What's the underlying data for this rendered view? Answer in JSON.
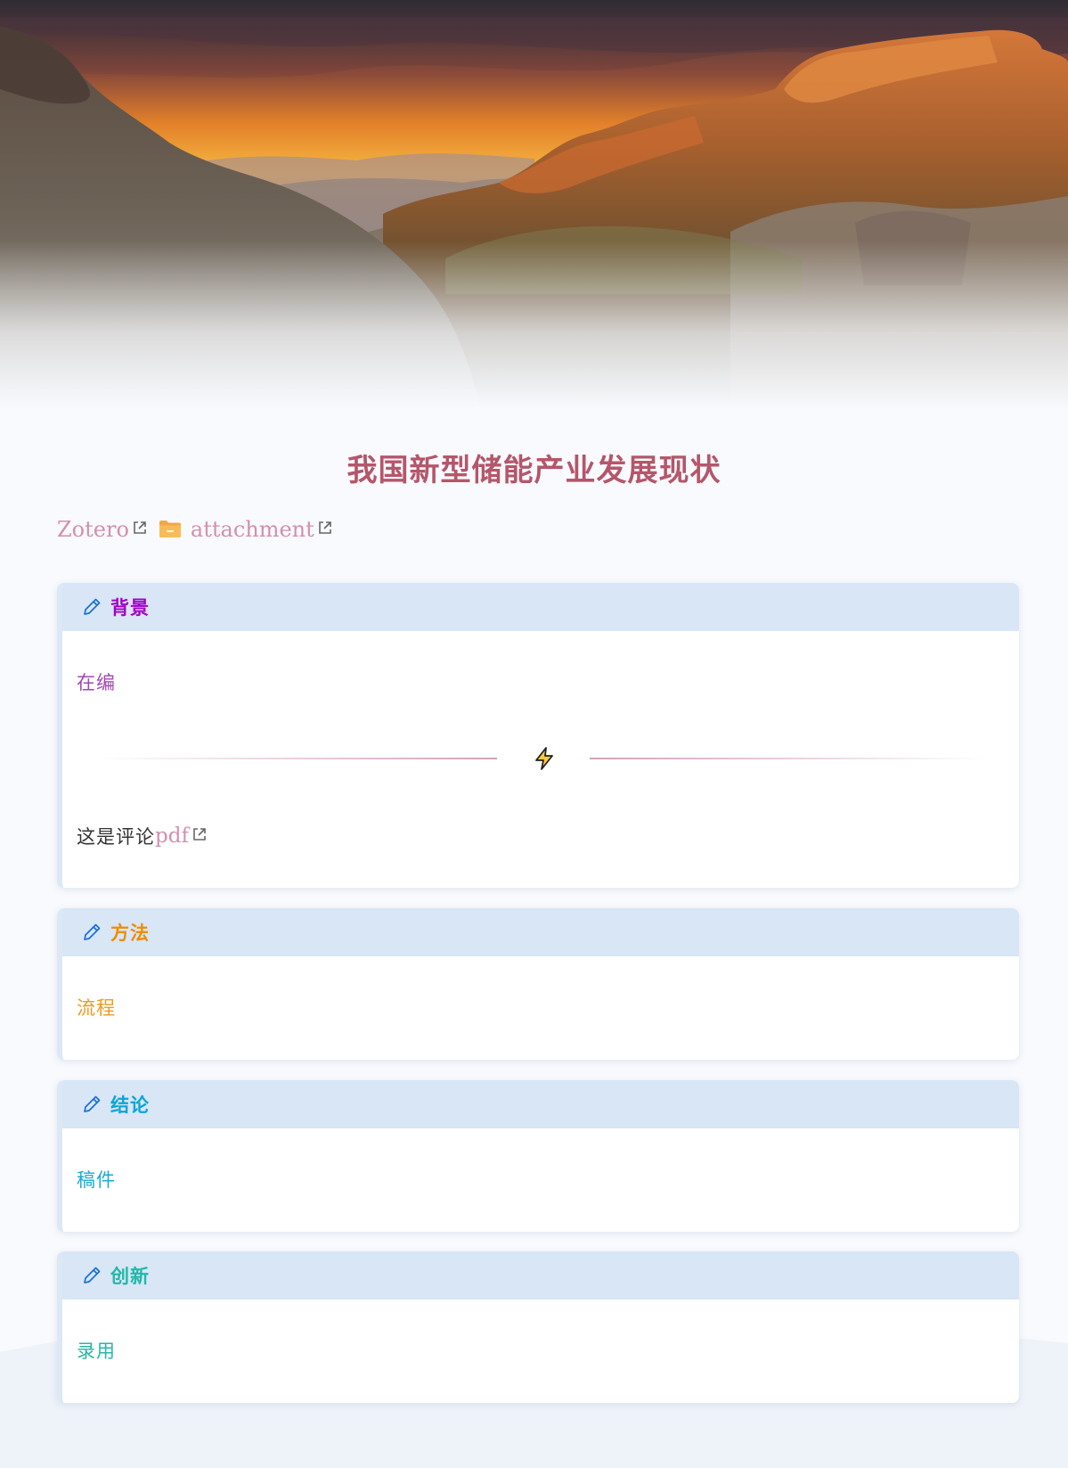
{
  "title": "我国新型储能产业发展现状",
  "links": {
    "zotero": "Zotero",
    "attachment": "attachment"
  },
  "cards": [
    {
      "heading": "背景",
      "body": "在编",
      "comment": "这是评论",
      "comment_link": "pdf",
      "color": "#a200c8"
    },
    {
      "heading": "方法",
      "body": "流程",
      "color": "#f08c00"
    },
    {
      "heading": "结论",
      "body": "稿件",
      "color": "#0aa6d6"
    },
    {
      "heading": "创新",
      "body": "录用",
      "color": "#20b8a8"
    }
  ],
  "icons": {
    "external_link": "external-link-icon",
    "folder": "folder-icon",
    "pencil": "pencil-icon",
    "bolt": "lightning-bolt-icon"
  },
  "colors": {
    "title": "#b5566a",
    "link": "#d38fb0",
    "card_header_bg": "#d8e6f6",
    "page_bg": "#f8fafd"
  }
}
